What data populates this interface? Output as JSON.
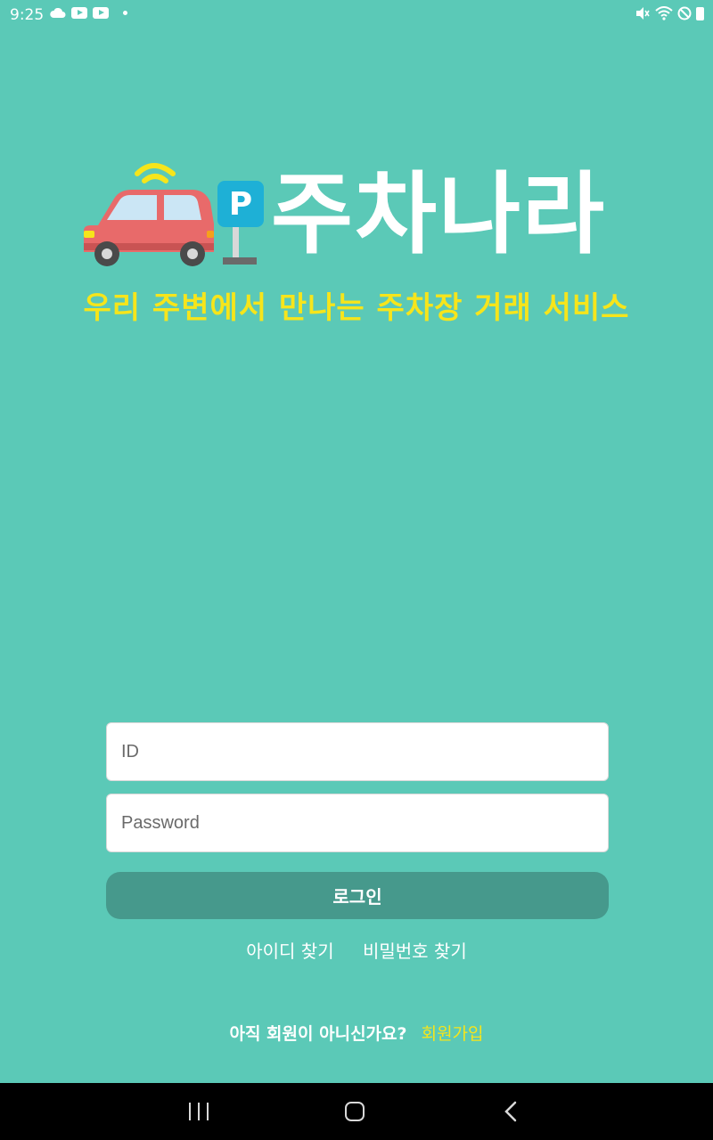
{
  "status_bar": {
    "time": "9:25",
    "left_icons": [
      "cloud-icon",
      "youtube-icon",
      "youtube-icon",
      "dot-icon"
    ],
    "right_icons": [
      "mute-icon",
      "wifi-icon",
      "do-not-disturb-icon",
      "battery-icon"
    ]
  },
  "brand": {
    "logo_icon": "car-parking-wifi-icon",
    "parking_sign": "P",
    "app_name": "주차나라",
    "tagline": "우리 주변에서 만나는 주차장 거래 서비스"
  },
  "form": {
    "id_placeholder": "ID",
    "password_placeholder": "Password",
    "login_label": "로그인",
    "find_id_label": "아이디 찾기",
    "find_password_label": "비밀번호 찾기"
  },
  "signup": {
    "question": "아직 회원이 아니신가요?",
    "link_label": "회원가입"
  },
  "nav": {
    "icons": [
      "recents-icon",
      "home-icon",
      "back-icon"
    ]
  },
  "colors": {
    "background": "#5bc9b7",
    "accent_yellow": "#f6e51b",
    "button": "#46998c"
  }
}
